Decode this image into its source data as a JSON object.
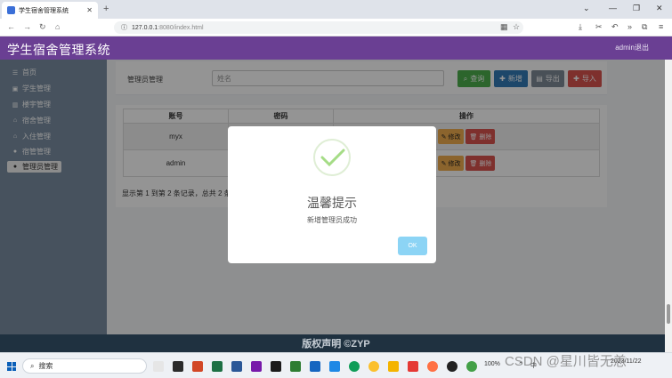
{
  "browser": {
    "tab_title": "学生宿舍管理系统",
    "url_host": "127.0.0.1",
    "url_path": ":8080/index.html"
  },
  "app": {
    "title": "学生宿舍管理系统",
    "logout_label": "admin退出"
  },
  "sidebar": {
    "items": [
      {
        "label": "首页",
        "icon": "list-icon"
      },
      {
        "label": "学生管理",
        "icon": "id-card-icon"
      },
      {
        "label": "楼宇管理",
        "icon": "building-icon"
      },
      {
        "label": "宿舍管理",
        "icon": "home-icon"
      },
      {
        "label": "入住管理",
        "icon": "home-icon"
      },
      {
        "label": "宿管管理",
        "icon": "user-icon"
      },
      {
        "label": "管理员管理",
        "icon": "user-icon",
        "active": true
      }
    ]
  },
  "search": {
    "label": "管理员管理",
    "placeholder": "姓名",
    "query_label": "查询",
    "add_label": "新增",
    "export_label": "导出",
    "import_label": "导入"
  },
  "table": {
    "headers": [
      "账号",
      "密码",
      "操作"
    ],
    "rows": [
      {
        "account": "myx",
        "password": ""
      },
      {
        "account": "admin",
        "password": ""
      }
    ],
    "edit_label": "修改",
    "delete_label": "删除",
    "pagination_text": "显示第 1 到第 2 条记录，总共 2 条"
  },
  "modal": {
    "title": "温馨提示",
    "message": "新增管理员成功",
    "ok_label": "OK"
  },
  "footer": {
    "text": "版权声明 ©ZYP"
  },
  "taskbar": {
    "search_label": "搜索",
    "tray_text": "中",
    "time": "",
    "date": "2023/11/22",
    "battery": "100%"
  },
  "watermark": "CSDN @星川皆无恙",
  "colors": {
    "header": "#6a3f93",
    "sidebar": "#7a8ea3",
    "query": "#4cae4c",
    "add": "#337ab7",
    "export": "#7f8a96",
    "import": "#d9534f",
    "success": "#a5dc86",
    "ok_button": "#8cd4f5"
  }
}
